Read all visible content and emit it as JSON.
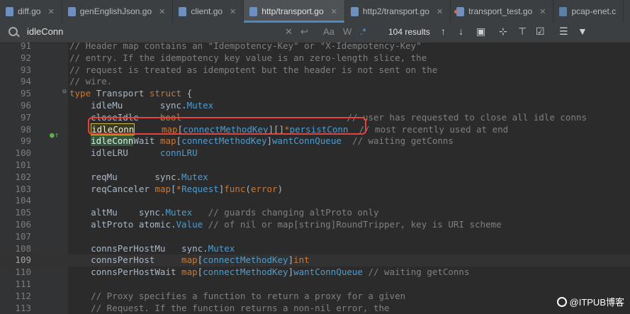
{
  "tabs": [
    {
      "label": "diff.go",
      "active": false,
      "icon": "go-file-icon"
    },
    {
      "label": "genEnglishJson.go",
      "active": false,
      "icon": "go-file-icon"
    },
    {
      "label": "client.go",
      "active": false,
      "icon": "go-file-icon"
    },
    {
      "label": "http/transport.go",
      "active": true,
      "icon": "go-file-icon"
    },
    {
      "label": "http2/transport.go",
      "active": false,
      "icon": "go-file-icon"
    },
    {
      "label": "transport_test.go",
      "active": false,
      "icon": "go-test-file-icon"
    },
    {
      "label": "pcap-enet.c",
      "active": false,
      "icon": "c-file-icon"
    }
  ],
  "search": {
    "query": "idleConn",
    "results": "104 results",
    "options": {
      "match_case": "Aa",
      "words": "W",
      "regex": ".*"
    }
  },
  "lines": [
    {
      "n": "91",
      "text": "// Header map contains an \"Idempotency-Key\" or \"X-Idempotency-Key\""
    },
    {
      "n": "92",
      "text": "// entry. If the idempotency key value is an zero-length slice, the"
    },
    {
      "n": "93",
      "text": "// request is treated as idempotent but the header is not sent on the"
    },
    {
      "n": "94",
      "text": "// wire."
    },
    {
      "n": "95",
      "text": "type Transport struct {"
    },
    {
      "n": "96",
      "text": "    idleMu       sync.Mutex"
    },
    {
      "n": "97",
      "text": "    closeIdle    bool                               // user has requested to close all idle conns"
    },
    {
      "n": "98",
      "text": "    idleConn     map[connectMethodKey][]*persistConn  // most recently used at end"
    },
    {
      "n": "99",
      "text": "    idleConnWait map[connectMethodKey]wantConnQueue  // waiting getConns"
    },
    {
      "n": "100",
      "text": "    idleLRU      connLRU"
    },
    {
      "n": "101",
      "text": ""
    },
    {
      "n": "102",
      "text": "    reqMu       sync.Mutex"
    },
    {
      "n": "103",
      "text": "    reqCanceler map[*Request]func(error)"
    },
    {
      "n": "104",
      "text": ""
    },
    {
      "n": "105",
      "text": "    altMu    sync.Mutex   // guards changing altProto only"
    },
    {
      "n": "106",
      "text": "    altProto atomic.Value // of nil or map[string]RoundTripper, key is URI scheme"
    },
    {
      "n": "107",
      "text": ""
    },
    {
      "n": "108",
      "text": "    connsPerHostMu   sync.Mutex"
    },
    {
      "n": "109",
      "text": "    connsPerHost     map[connectMethodKey]int"
    },
    {
      "n": "110",
      "text": "    connsPerHostWait map[connectMethodKey]wantConnQueue // waiting getConns"
    },
    {
      "n": "111",
      "text": ""
    },
    {
      "n": "112",
      "text": "    // Proxy specifies a function to return a proxy for a given"
    },
    {
      "n": "113",
      "text": "    // Request. If the function returns a non-nil error, the"
    }
  ],
  "watermark": "@ITPUB博客",
  "colors": {
    "comment": "#808080",
    "keyword": "#cc7832",
    "type": "#4f9ccf",
    "highlight_box": "#e0443c"
  }
}
